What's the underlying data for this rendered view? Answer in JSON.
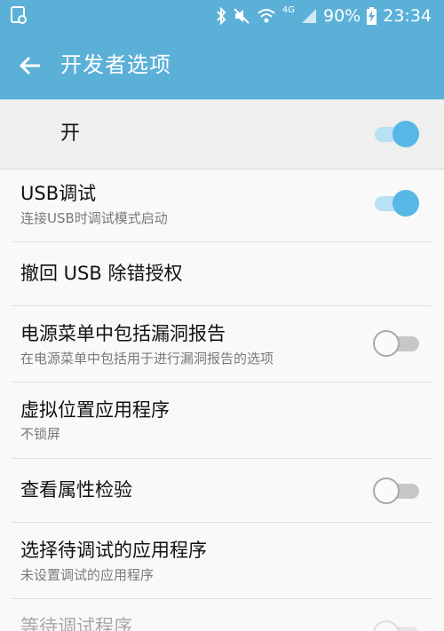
{
  "status_bar": {
    "battery_percent": "90%",
    "time": "23:34",
    "network": "4G",
    "icons": [
      "screenshot-notification-icon",
      "bluetooth-icon",
      "mute-icon",
      "wifi-icon",
      "signal-icon",
      "battery-charging-icon"
    ]
  },
  "app_bar": {
    "title": "开发者选项",
    "back_icon": "arrow-left-icon"
  },
  "master_switch": {
    "label": "开",
    "on": true
  },
  "settings": [
    {
      "title": "USB调试",
      "subtitle": "连接USB时调试模式启动",
      "toggle": "on"
    },
    {
      "title": "撤回 USB 除错授权"
    },
    {
      "title": "电源菜单中包括漏洞报告",
      "subtitle": "在电源菜单中包括用于进行漏洞报告的选项",
      "toggle": "off"
    },
    {
      "title": "虚拟位置应用程序",
      "subtitle": "不锁屏"
    },
    {
      "title": "查看属性检验",
      "toggle": "off"
    },
    {
      "title": "选择待调试的应用程序",
      "subtitle": "未设置调试的应用程序"
    },
    {
      "title": "等待调试程序",
      "toggle": "off",
      "disabled": true
    }
  ],
  "colors": {
    "accent": "#5bb0d8",
    "toggle_on": "#57b8e6",
    "toggle_on_track": "#b8e1f4"
  }
}
